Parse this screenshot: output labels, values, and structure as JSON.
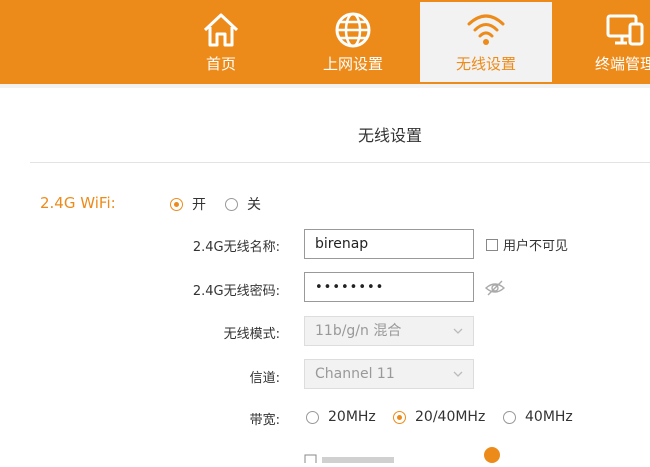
{
  "nav": {
    "tabs": [
      {
        "label": "首页",
        "icon": "home-icon"
      },
      {
        "label": "上网设置",
        "icon": "globe-icon"
      },
      {
        "label": "无线设置",
        "icon": "wifi-icon"
      },
      {
        "label": "终端管理",
        "icon": "devices-icon"
      }
    ],
    "active_tab": "无线设置",
    "colors": {
      "accent": "#ed8b1a",
      "active_tab_bg": "#f2f2f2"
    }
  },
  "page": {
    "title": "无线设置"
  },
  "wifi24": {
    "section_label": "2.4G WiFi:",
    "toggle": {
      "on_label": "开",
      "off_label": "关",
      "selected": "开"
    },
    "ssid": {
      "label": "2.4G无线名称:",
      "value": "birenap"
    },
    "hide_ssid": {
      "label": "用户不可见",
      "checked": false
    },
    "password": {
      "label": "2.4G无线密码:",
      "value": "••••••••"
    },
    "mode": {
      "label": "无线模式:",
      "value": "11b/g/n 混合"
    },
    "channel": {
      "label": "信道:",
      "value": "Channel 11"
    },
    "bandwidth": {
      "label": "带宽:",
      "options": [
        "20MHz",
        "20/40MHz",
        "40MHz"
      ],
      "selected": "20/40MHz"
    }
  }
}
